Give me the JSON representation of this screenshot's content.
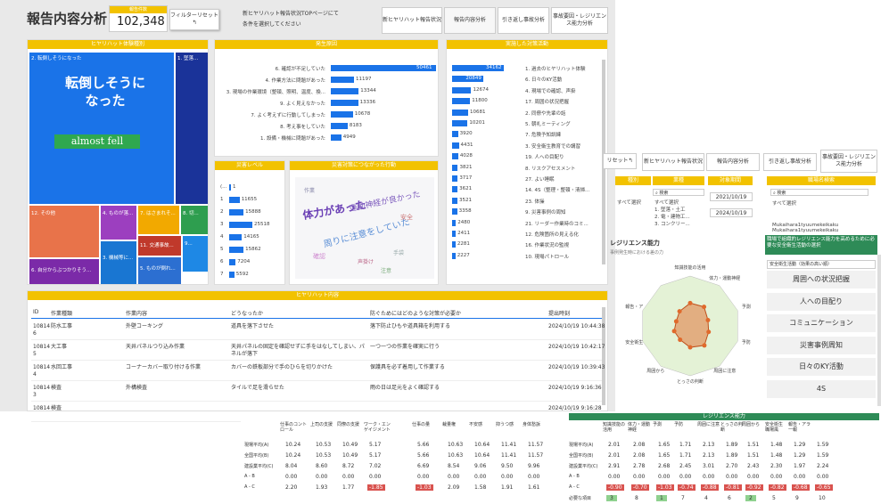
{
  "header": {
    "title": "報告内容分析",
    "kpi_label": "報告件数",
    "kpi_value": "102,348",
    "filter_reset": "フィルターリセット↰",
    "info": "新ヒヤリハット報告状況TOPページにて\n条件を選択してください",
    "tabs": [
      "新ヒヤリハット報告状況",
      "報告内容分析",
      "引き返し事故分析",
      "事故要因・レジリエンス能力分析"
    ]
  },
  "treemap": {
    "title": "ヒヤリハット体験種別",
    "items": [
      {
        "label": "2. 転倒しそうになった",
        "color": "#1a73e8"
      },
      {
        "label": "1. 墜落...",
        "color": "#1a3399"
      },
      {
        "label": "12. その他",
        "color": "#e8734a"
      },
      {
        "label": "4. ものが落...",
        "color": "#9c3fbf"
      },
      {
        "label": "7. はさまれそ...",
        "color": "#f2a900"
      },
      {
        "label": "8. 切...",
        "color": "#2e9e4f"
      },
      {
        "label": "11. 交通事故...",
        "color": "#c0392b"
      },
      {
        "label": "9...",
        "color": "#1e88e5"
      },
      {
        "label": "6. 自分からぶつかりそう...",
        "color": "#7b2aa8"
      },
      {
        "label": "3. 機械等に...",
        "color": "#1976d2"
      },
      {
        "label": "5. ものが倒れ...",
        "color": "#2c6fd1"
      }
    ],
    "overlay_jp": "転倒しそうに\nなった",
    "overlay_en": "almost fell"
  },
  "hassei": {
    "title": "発生原因",
    "rows": [
      {
        "label": "6. 確認が不足していた",
        "value": 50461,
        "frac": 1.0
      },
      {
        "label": "4. 作業方法に問題があった",
        "value": 11197,
        "frac": 0.22
      },
      {
        "label": "3. 現場の作業環境（整頓、照明、温度、換...",
        "value": 13344,
        "frac": 0.265
      },
      {
        "label": "9. よく見えなかった",
        "value": 13336,
        "frac": 0.26
      },
      {
        "label": "7. よく考えずに行動してしまった",
        "value": 10678,
        "frac": 0.21
      },
      {
        "label": "8. 考え事をしていた",
        "value": 8183,
        "frac": 0.16
      },
      {
        "label": "1. 設備・機械に問題があった",
        "value": 4949,
        "frac": 0.1
      }
    ]
  },
  "jissi": {
    "title": "実施した対策活動",
    "rows": [
      {
        "value": "34162",
        "frac": 1.0,
        "label": "1. 過去のヒヤリハット体験"
      },
      {
        "value": "20849",
        "frac": 0.61,
        "label": "6. 日々のKY活動"
      },
      {
        "value": "12674",
        "frac": 0.37,
        "label": "4. 現場での確認、声掛"
      },
      {
        "value": "11800",
        "frac": 0.35,
        "label": "17. 周囲の状況把握"
      },
      {
        "value": "10681",
        "frac": 0.31,
        "label": "2. 同僚や先輩の話"
      },
      {
        "value": "10201",
        "frac": 0.3,
        "label": "5. 朝礼ミーティング"
      },
      {
        "value": "3920",
        "frac": 0.115,
        "label": "7. 危険予知訓練"
      },
      {
        "value": "4431",
        "frac": 0.13,
        "label": "3. 安全衛生教育での講習"
      },
      {
        "value": "4028",
        "frac": 0.118,
        "label": "19. 人への目配り"
      },
      {
        "value": "3821",
        "frac": 0.112,
        "label": "8. リスクアセスメント"
      },
      {
        "value": "3717",
        "frac": 0.109,
        "label": "27. よい睡眠"
      },
      {
        "value": "3621",
        "frac": 0.106,
        "label": "14. 4S（整理・整頓・清掃..."
      },
      {
        "value": "3521",
        "frac": 0.103,
        "label": "23. 体操"
      },
      {
        "value": "3358",
        "frac": 0.098,
        "label": "9. 災害事例の周知"
      },
      {
        "value": "2480",
        "frac": 0.073,
        "label": "21. リーダー作業時のコミ..."
      },
      {
        "value": "2411",
        "frac": 0.071,
        "label": "12. 危険箇所の見える化"
      },
      {
        "value": "2281",
        "frac": 0.067,
        "label": "16. 作業状況の監視"
      },
      {
        "value": "2227",
        "frac": 0.065,
        "label": "10. 現場パトロール"
      }
    ]
  },
  "level": {
    "title": "災害レベル",
    "rows": [
      {
        "label": "(...",
        "value": "1",
        "frac": 0.0
      },
      {
        "label": "1",
        "value": "11655",
        "frac": 0.45
      },
      {
        "label": "2",
        "value": "15888",
        "frac": 0.62
      },
      {
        "label": "3",
        "value": "25518",
        "frac": 1.0
      },
      {
        "label": "4",
        "value": "14165",
        "frac": 0.55
      },
      {
        "label": "5",
        "value": "15862",
        "frac": 0.62
      },
      {
        "label": "6",
        "value": "7204",
        "frac": 0.28
      },
      {
        "label": "7",
        "value": "5592",
        "frac": 0.22
      }
    ]
  },
  "wordcloud": {
    "title": "災害対策につながった行動",
    "words": [
      "体力があった",
      "運動神経が良かった",
      "周りに注意をしていた",
      "確認",
      "手袋",
      "声掛け",
      "作業",
      "安全",
      "注意"
    ]
  },
  "table": {
    "title": "ヒヤリハット内容",
    "headers": [
      "ID",
      "作業種類",
      "作業内容",
      "どうなったか",
      "防ぐためにはどのような対策が必要か",
      "提出時刻"
    ],
    "rows": [
      [
        "10814\n6",
        "防水工事",
        "外壁コーキング",
        "道具を落下させた",
        "落下防止ひもや道具箱を利用する",
        "2024/10/19 10:44:38"
      ],
      [
        "10814\n5",
        "大工事",
        "天井パネルつり込み作業",
        "天井パネルの固定を確認せずに手をはなしてしまい、パネルが落下",
        "一つ一つの作業を確実に行う",
        "2024/10/19 10:42:17"
      ],
      [
        "10814\n4",
        "水回工事",
        "コーナーカバー取り付ける作業",
        "カバーの鉄板部分で手のひらを切りかけた",
        "保護具を必ず着用して作業する",
        "2024/10/19 10:39:43"
      ],
      [
        "10814\n3",
        "検査",
        "外構検査",
        "タイルで足を滑らせた",
        "雨の日は足元をよく確認する",
        "2024/10/19 9:16:36"
      ],
      [
        "10814",
        "検査",
        "",
        "",
        "",
        "2024/10/19 9:16:28"
      ]
    ]
  },
  "back": {
    "reset": "リセット↰",
    "tabs": [
      "新ヒヤリハット報告状況",
      "報告内容分析",
      "引き返し事故分析",
      "事故要因・レジリエンス能力分析"
    ],
    "cols": [
      "種別",
      "業種",
      "対象期間",
      "職場名検索"
    ],
    "search": "検索",
    "check_all": "すべて選択",
    "checks1": [
      "すべて選択",
      "1. 墜落・土工",
      "2. 電・建物工..."
    ],
    "checks2": [
      "すべて選択",
      "3. コンクリー..."
    ],
    "dates": [
      "2021/10/19",
      "2024/10/19"
    ],
    "check3": [
      "Mukaihara1tyuumekeikaku",
      "Mukaihara1tyuumekeikaku"
    ],
    "left_labels": [
      "職種",
      "全体",
      "作業"
    ]
  },
  "radar": {
    "title": "レジリエンス能力",
    "subtitle": "事例発生時における差の力",
    "labels": [
      "知識技能の活用",
      "体力・運動神経",
      "予測",
      "予防",
      "周囲に注意",
      "とっさの判断",
      "周囲から",
      "安全衛生",
      "報告・ア"
    ]
  },
  "side": {
    "heading": "職場で組織的レジリエンス能力を高めるために必要な安全衛生活動の選択",
    "sub": "安全衛生活動（効果の高い順）",
    "items": [
      "周囲への状況把握",
      "人への目配り",
      "コミュニケーション",
      "災害事例周知",
      "日々のKY活動",
      "4S"
    ]
  },
  "stats": {
    "title": "レジリエンス能力",
    "left_headers": [
      "仕事のコントロール",
      "上司の支援",
      "同僚の支援",
      "ワーク・エンゲイジメント"
    ],
    "mid_headers": [
      "仕事の量",
      "裁量権",
      "不安感",
      "抑うつ感",
      "身体愁訴"
    ],
    "right_headers": [
      "知識技能の活用",
      "体力・運動神経",
      "予測",
      "予防",
      "周囲に注意",
      "とっさの判断",
      "周囲から",
      "安全衛生 職場風",
      "報告・アラ一報"
    ],
    "row_labels": [
      "現場平均(A)",
      "全国平均(B)",
      "建設業平均(C)",
      "A - B",
      "A - C"
    ],
    "left": [
      [
        "10.24",
        "10.53",
        "10.49",
        "5.17"
      ],
      [
        "10.24",
        "10.53",
        "10.49",
        "5.17"
      ],
      [
        "8.04",
        "8.60",
        "8.72",
        "7.02"
      ],
      [
        "0.00",
        "0.00",
        "0.00",
        "0.00"
      ],
      [
        "2.20",
        "1.93",
        "1.77",
        "-1.85"
      ]
    ],
    "mid": [
      [
        "5.66",
        "10.63",
        "10.64",
        "11.41",
        "11.57"
      ],
      [
        "5.66",
        "10.63",
        "10.64",
        "11.41",
        "11.57"
      ],
      [
        "6.69",
        "8.54",
        "9.06",
        "9.50",
        "9.96"
      ],
      [
        "0.00",
        "0.00",
        "0.00",
        "0.00",
        "0.00"
      ],
      [
        "-1.03",
        "2.09",
        "1.58",
        "1.91",
        "1.61"
      ]
    ],
    "right": [
      [
        "2.01",
        "2.08",
        "1.65",
        "1.71",
        "2.13",
        "1.89",
        "1.51",
        "1.48",
        "1.29",
        "1.59"
      ],
      [
        "2.01",
        "2.08",
        "1.65",
        "1.71",
        "2.13",
        "1.89",
        "1.51",
        "1.48",
        "1.29",
        "1.59"
      ],
      [
        "2.91",
        "2.78",
        "2.68",
        "2.45",
        "3.01",
        "2.70",
        "2.43",
        "2.30",
        "1.97",
        "2.24"
      ],
      [
        "0.00",
        "0.00",
        "0.00",
        "0.00",
        "0.00",
        "0.00",
        "0.00",
        "0.00",
        "0.00",
        "0.00"
      ],
      [
        "-0.90",
        "-0.70",
        "-1.03",
        "-0.74",
        "-0.88",
        "-0.81",
        "-0.92",
        "-0.82",
        "-0.68",
        "-0.65"
      ]
    ],
    "rank_label": "必要な項目",
    "rank": [
      "3",
      "8",
      "1",
      "7",
      "4",
      "6",
      "2",
      "5",
      "9",
      "10"
    ]
  }
}
